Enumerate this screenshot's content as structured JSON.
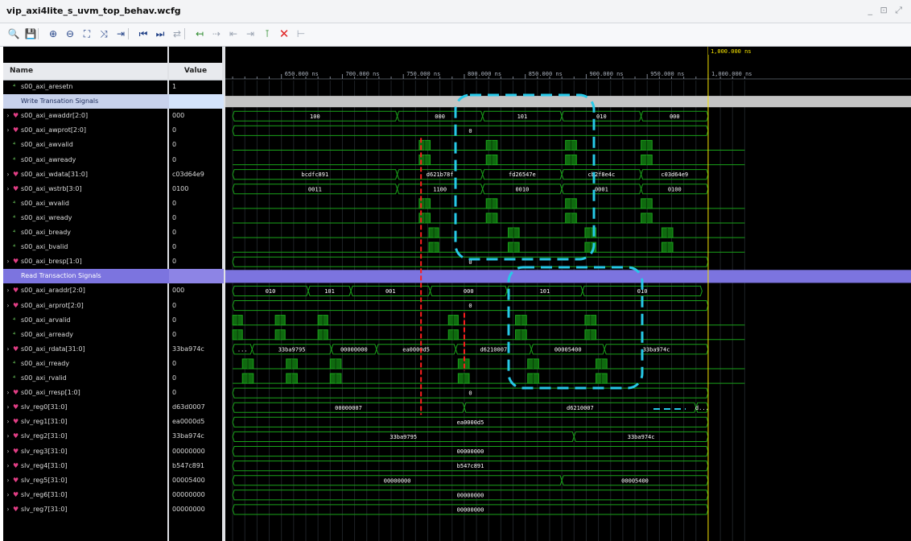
{
  "window": {
    "title": "vip_axi4lite_s_uvm_top_behav.wcfg",
    "controls": "_ ⊡ ⤢"
  },
  "toolbar": {
    "buttons": [
      {
        "name": "search-icon",
        "glyph": "🔍"
      },
      {
        "name": "save-icon",
        "glyph": "💾"
      },
      {
        "name": "zoom-in-icon",
        "glyph": "⊕"
      },
      {
        "name": "zoom-out-icon",
        "glyph": "⊖"
      },
      {
        "name": "zoom-fit-icon",
        "glyph": "⛶"
      },
      {
        "name": "go-to-cursor-icon",
        "glyph": "⤨"
      },
      {
        "name": "add-marker-icon",
        "glyph": "⇥"
      },
      {
        "name": "go-to-start-icon",
        "glyph": "⏮"
      },
      {
        "name": "go-to-end-icon",
        "glyph": "⏭"
      },
      {
        "name": "swap-icon",
        "glyph": "⇄"
      },
      {
        "name": "prev-transition-icon",
        "glyph": "↤"
      },
      {
        "name": "next-transition-icon",
        "glyph": "⇢"
      },
      {
        "name": "prev-marker-icon",
        "glyph": "⇤"
      },
      {
        "name": "next-marker-icon",
        "glyph": "⇥"
      },
      {
        "name": "insert-marker-icon",
        "glyph": "⊺"
      },
      {
        "name": "delete-icon",
        "glyph": "✕"
      },
      {
        "name": "snap-icon",
        "glyph": "⊢"
      }
    ]
  },
  "columns": {
    "name": "Name",
    "value": "Value"
  },
  "cursor_label": "1,000.000 ns",
  "axis": {
    "ticks": [
      {
        "t": 650,
        "label": "650.000 ns"
      },
      {
        "t": 700,
        "label": "700.000 ns"
      },
      {
        "t": 750,
        "label": "750.000 ns"
      },
      {
        "t": 800,
        "label": "800.000 ns"
      },
      {
        "t": 850,
        "label": "850.000 ns"
      },
      {
        "t": 900,
        "label": "900.000 ns"
      },
      {
        "t": 950,
        "label": "950.000 ns"
      },
      {
        "t": 1000,
        "label": "1,000.000 ns"
      }
    ]
  },
  "rows": [
    {
      "name": "s00_axi_aresetn",
      "value": "1",
      "kind": "bit",
      "partial": true
    },
    {
      "name": "Write Transation Signals",
      "value": "",
      "kind": "group-write"
    },
    {
      "name": "s00_axi_awaddr[2:0]",
      "value": "000",
      "kind": "bus",
      "segs": [
        {
          "v": "100",
          "a": 610,
          "b": 745
        },
        {
          "v": "000",
          "a": 745,
          "b": 815
        },
        {
          "v": "101",
          "a": 815,
          "b": 880
        },
        {
          "v": "010",
          "a": 880,
          "b": 945
        },
        {
          "v": "000",
          "a": 945,
          "b": 1000
        }
      ]
    },
    {
      "name": "s00_axi_awprot[2:0]",
      "value": "0",
      "kind": "bus",
      "segs": [
        {
          "v": "0",
          "a": 610,
          "b": 1000
        }
      ]
    },
    {
      "name": "s00_axi_awvalid",
      "value": "0",
      "kind": "bit",
      "pulses": [
        [
          763,
          772
        ],
        [
          818,
          827
        ],
        [
          883,
          892
        ],
        [
          945,
          954
        ]
      ]
    },
    {
      "name": "s00_axi_awready",
      "value": "0",
      "kind": "bit",
      "pulses": [
        [
          763,
          772
        ],
        [
          818,
          827
        ],
        [
          883,
          892
        ],
        [
          945,
          954
        ]
      ]
    },
    {
      "name": "s00_axi_wdata[31:0]",
      "value": "c03d64e9",
      "kind": "bus",
      "segs": [
        {
          "v": "bcdfc891",
          "a": 610,
          "b": 745
        },
        {
          "v": "d621b78f",
          "a": 745,
          "b": 815
        },
        {
          "v": "fd26547e",
          "a": 815,
          "b": 880
        },
        {
          "v": "cb2f8e4c",
          "a": 880,
          "b": 945
        },
        {
          "v": "c03d64e9",
          "a": 945,
          "b": 1000
        }
      ]
    },
    {
      "name": "s00_axi_wstrb[3:0]",
      "value": "0100",
      "kind": "bus",
      "segs": [
        {
          "v": "0011",
          "a": 610,
          "b": 745
        },
        {
          "v": "1100",
          "a": 745,
          "b": 815
        },
        {
          "v": "0010",
          "a": 815,
          "b": 880
        },
        {
          "v": "0001",
          "a": 880,
          "b": 945
        },
        {
          "v": "0100",
          "a": 945,
          "b": 1000
        }
      ]
    },
    {
      "name": "s00_axi_wvalid",
      "value": "0",
      "kind": "bit",
      "pulses": [
        [
          763,
          772
        ],
        [
          818,
          827
        ],
        [
          883,
          892
        ],
        [
          945,
          954
        ]
      ]
    },
    {
      "name": "s00_axi_wready",
      "value": "0",
      "kind": "bit",
      "pulses": [
        [
          763,
          772
        ],
        [
          818,
          827
        ],
        [
          883,
          892
        ],
        [
          945,
          954
        ]
      ]
    },
    {
      "name": "s00_axi_bready",
      "value": "0",
      "kind": "bit",
      "pulses": [
        [
          771,
          779
        ],
        [
          836,
          845
        ],
        [
          899,
          908
        ],
        [
          962,
          971
        ]
      ]
    },
    {
      "name": "s00_axi_bvalid",
      "value": "0",
      "kind": "bit",
      "pulses": [
        [
          771,
          779
        ],
        [
          836,
          845
        ],
        [
          899,
          908
        ],
        [
          962,
          971
        ]
      ]
    },
    {
      "name": "s00_axi_bresp[1:0]",
      "value": "0",
      "kind": "bus",
      "segs": [
        {
          "v": "0",
          "a": 610,
          "b": 1000
        }
      ]
    },
    {
      "name": "Read Transaction Signals",
      "value": "",
      "kind": "group-read"
    },
    {
      "name": "s00_axi_araddr[2:0]",
      "value": "000",
      "kind": "bus",
      "segs": [
        {
          "v": "010",
          "a": 610,
          "b": 672
        },
        {
          "v": "101",
          "a": 672,
          "b": 707
        },
        {
          "v": "001",
          "a": 707,
          "b": 772
        },
        {
          "v": "000",
          "a": 772,
          "b": 835
        },
        {
          "v": "101",
          "a": 835,
          "b": 897
        },
        {
          "v": "010",
          "a": 897,
          "b": 995
        }
      ]
    },
    {
      "name": "s00_axi_arprot[2:0]",
      "value": "0",
      "kind": "bus",
      "segs": [
        {
          "v": "0",
          "a": 610,
          "b": 1000
        }
      ]
    },
    {
      "name": "s00_axi_arvalid",
      "value": "0",
      "kind": "bit",
      "pulses": [
        [
          610,
          618
        ],
        [
          645,
          653
        ],
        [
          680,
          688
        ],
        [
          787,
          795
        ],
        [
          842,
          851
        ],
        [
          899,
          908
        ]
      ]
    },
    {
      "name": "s00_axi_arready",
      "value": "0",
      "kind": "bit",
      "pulses": [
        [
          610,
          618
        ],
        [
          645,
          653
        ],
        [
          680,
          688
        ],
        [
          787,
          795
        ],
        [
          842,
          851
        ],
        [
          899,
          908
        ]
      ]
    },
    {
      "name": "s00_axi_rdata[31:0]",
      "value": "33ba974c",
      "kind": "bus",
      "segs": [
        {
          "v": "...",
          "a": 610,
          "b": 626
        },
        {
          "v": "33ba9795",
          "a": 626,
          "b": 691
        },
        {
          "v": "00000000",
          "a": 691,
          "b": 728
        },
        {
          "v": "ea0000d5",
          "a": 728,
          "b": 793
        },
        {
          "v": "d6210007",
          "a": 793,
          "b": 855
        },
        {
          "v": "00005400",
          "a": 855,
          "b": 915
        },
        {
          "v": "33ba974c",
          "a": 915,
          "b": 1000
        }
      ]
    },
    {
      "name": "s00_axi_rready",
      "value": "0",
      "kind": "bit",
      "pulses": [
        [
          618,
          627
        ],
        [
          654,
          663
        ],
        [
          690,
          699
        ],
        [
          795,
          804
        ],
        [
          852,
          861
        ],
        [
          908,
          917
        ]
      ]
    },
    {
      "name": "s00_axi_rvalid",
      "value": "0",
      "kind": "bit",
      "pulses": [
        [
          618,
          627
        ],
        [
          654,
          663
        ],
        [
          690,
          699
        ],
        [
          795,
          804
        ],
        [
          852,
          861
        ],
        [
          908,
          917
        ]
      ]
    },
    {
      "name": "s00_axi_rresp[1:0]",
      "value": "0",
      "kind": "bus",
      "segs": [
        {
          "v": "0",
          "a": 610,
          "b": 1000
        }
      ]
    },
    {
      "name": "slv_reg0[31:0]",
      "value": "d63d0007",
      "kind": "bus",
      "segs": [
        {
          "v": "00000007",
          "a": 610,
          "b": 800
        },
        {
          "v": "d6210007",
          "a": 800,
          "b": 990
        },
        {
          "v": "d...",
          "a": 990,
          "b": 1000
        }
      ]
    },
    {
      "name": "slv_reg1[31:0]",
      "value": "ea0000d5",
      "kind": "bus",
      "segs": [
        {
          "v": "ea0000d5",
          "a": 610,
          "b": 1000
        }
      ]
    },
    {
      "name": "slv_reg2[31:0]",
      "value": "33ba974c",
      "kind": "bus",
      "segs": [
        {
          "v": "33ba9795",
          "a": 610,
          "b": 890
        },
        {
          "v": "33ba974c",
          "a": 890,
          "b": 1000
        }
      ]
    },
    {
      "name": "slv_reg3[31:0]",
      "value": "00000000",
      "kind": "bus",
      "segs": [
        {
          "v": "00000000",
          "a": 610,
          "b": 1000
        }
      ]
    },
    {
      "name": "slv_reg4[31:0]",
      "value": "b547c891",
      "kind": "bus",
      "segs": [
        {
          "v": "b547c891",
          "a": 610,
          "b": 1000
        }
      ]
    },
    {
      "name": "slv_reg5[31:0]",
      "value": "00005400",
      "kind": "bus",
      "segs": [
        {
          "v": "00000000",
          "a": 610,
          "b": 880
        },
        {
          "v": "00005400",
          "a": 880,
          "b": 1000
        }
      ]
    },
    {
      "name": "slv_reg6[31:0]",
      "value": "00000000",
      "kind": "bus",
      "segs": [
        {
          "v": "00000000",
          "a": 610,
          "b": 1000
        }
      ]
    },
    {
      "name": "slv_reg7[31:0]",
      "value": "00000000",
      "kind": "bus",
      "segs": [
        {
          "v": "00000000",
          "a": 610,
          "b": 1000
        }
      ]
    }
  ],
  "colors": {
    "wave_line": "#1aa31a",
    "wave_fill": "#0f6a0f",
    "bus_text": "#ffffff",
    "cursor": "#f7e400",
    "marker": "#ff1e1e",
    "annotation": "#26c9e8",
    "group_write_band": "#c4c4c4",
    "group_read_band": "#7c74df"
  },
  "annotations": {
    "write_box": "dashed cyan highlight around AW/W handshake at 750–830 ns",
    "read_box": "dashed cyan highlight around AR/R handshake at 790–860 ns"
  }
}
